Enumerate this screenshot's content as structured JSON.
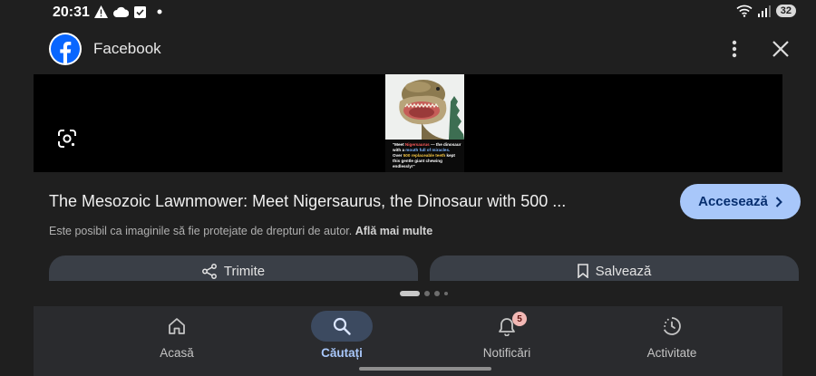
{
  "status_bar": {
    "time": "20:31",
    "battery": "32",
    "icons": [
      "warning-icon",
      "cloud-icon",
      "check-box-icon",
      "dot-icon",
      "wifi-icon",
      "signal-icon"
    ]
  },
  "header": {
    "title": "Facebook",
    "icons": [
      "facebook-logo-icon",
      "more-vert-icon",
      "close-icon"
    ]
  },
  "image": {
    "caption_lead": "\"Meet ",
    "caption_name": "Nigersaurus",
    "caption_mid": " — the dinosaur with a ",
    "caption_mouth": "mouth full of miracles.",
    "caption_line2_a": "Over ",
    "caption_teeth": "500 replaceable teeth",
    "caption_line2_b": " kept this gentle giant chewing endlessly!\""
  },
  "result": {
    "title": "The Mesozoic Lawnmower: Meet Nigersaurus, the Dinosaur with 500 ...",
    "visit_label": "Accesează",
    "copyright_text": "Este posibil ca imaginile să fie protejate de drepturi de autor.",
    "learn_more": "Află mai multe"
  },
  "actions": {
    "share_label": "Trimite",
    "save_label": "Salvează"
  },
  "pager": {
    "total": 4,
    "current": 1
  },
  "bottom_nav": {
    "items": [
      {
        "label": "Acasă",
        "icon": "home-icon",
        "active": false
      },
      {
        "label": "Căutați",
        "icon": "search-icon",
        "active": true
      },
      {
        "label": "Notificări",
        "icon": "bell-icon",
        "active": false,
        "badge": "5"
      },
      {
        "label": "Activitate",
        "icon": "history-icon",
        "active": false
      }
    ]
  },
  "colors": {
    "background": "#1f1f1f",
    "accent": "#a8c7fa",
    "button_surface": "#3a3f47",
    "nav_surface": "#2a2b2e",
    "badge": "#f2b8b5"
  }
}
